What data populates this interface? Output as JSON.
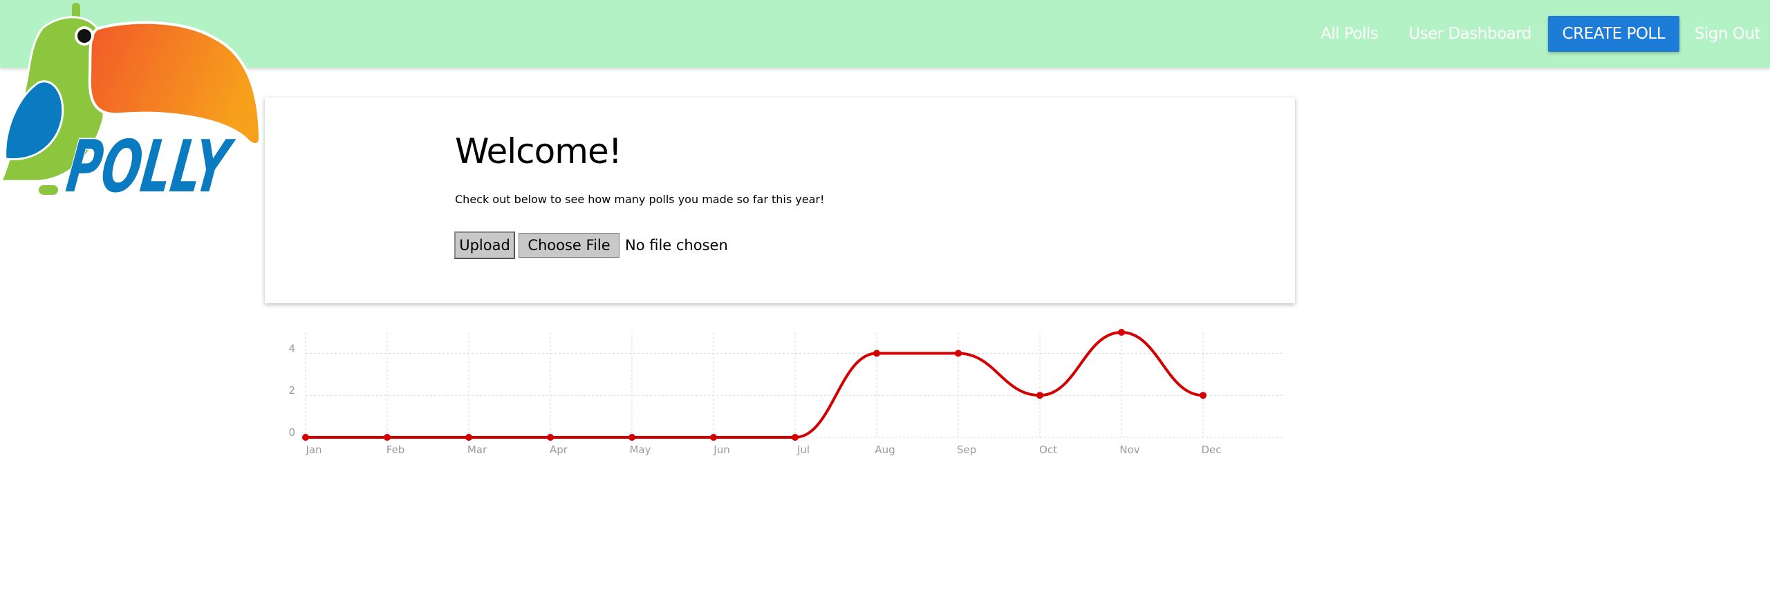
{
  "nav": {
    "all_polls": "All Polls",
    "user_dashboard": "User Dashboard",
    "create_poll": "CREATE POLL",
    "sign_out": "Sign Out"
  },
  "logo": {
    "text": "POLLY",
    "colors": {
      "body": "#8cc63f",
      "beak_start": "#f15a29",
      "beak_end": "#f7a01c",
      "wing": "#0a7bc1"
    }
  },
  "card": {
    "title": "Welcome!",
    "subtitle": "Check out below to see how many polls you made so far this year!",
    "upload_label": "Upload",
    "choose_file_label": "Choose File",
    "file_status": "No file chosen"
  },
  "colors": {
    "navbar": "#b3f2c4",
    "create_button": "#1e7cd9",
    "line": "#d40000"
  },
  "chart_data": {
    "type": "line",
    "categories": [
      "Jan",
      "Feb",
      "Mar",
      "Apr",
      "May",
      "Jun",
      "Jul",
      "Aug",
      "Sep",
      "Oct",
      "Nov",
      "Dec"
    ],
    "series": [
      {
        "values": [
          0,
          0,
          0,
          0,
          0,
          0,
          0,
          4,
          4,
          2,
          5,
          2
        ]
      }
    ],
    "y_ticks": [
      "0",
      "2",
      "4"
    ],
    "ylim": [
      0,
      5
    ],
    "grid": true,
    "smooth": true,
    "color": "#d40000"
  }
}
